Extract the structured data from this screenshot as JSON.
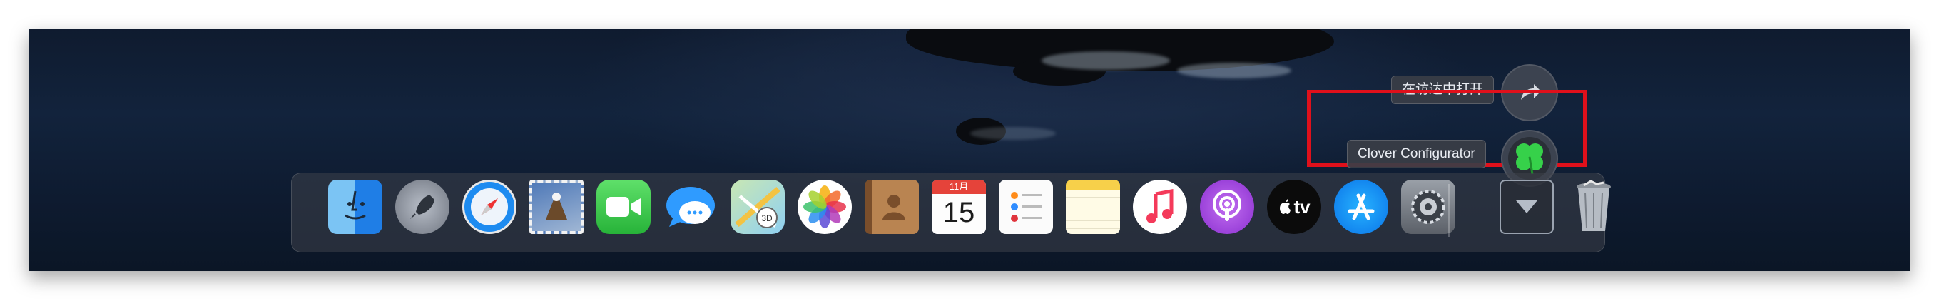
{
  "popup": {
    "open_in_finder_label": "在访达中打开",
    "clover_label": "Clover Configurator"
  },
  "dock": {
    "items": [
      {
        "name": "finder-icon"
      },
      {
        "name": "launchpad-icon"
      },
      {
        "name": "safari-icon"
      },
      {
        "name": "mail-icon"
      },
      {
        "name": "facetime-icon"
      },
      {
        "name": "messages-icon"
      },
      {
        "name": "maps-icon"
      },
      {
        "name": "photos-icon"
      },
      {
        "name": "contacts-icon"
      },
      {
        "name": "calendar-icon",
        "month": "11月",
        "day": "15"
      },
      {
        "name": "reminders-icon"
      },
      {
        "name": "notes-icon"
      },
      {
        "name": "music-icon"
      },
      {
        "name": "podcasts-icon"
      },
      {
        "name": "apple-tv-icon",
        "label": "tv"
      },
      {
        "name": "app-store-icon"
      },
      {
        "name": "system-preferences-icon"
      },
      {
        "name": "downloads-stack-icon"
      },
      {
        "name": "trash-icon"
      }
    ]
  },
  "colors": {
    "highlight": "#e0101b",
    "clover_green": "#2ecc40"
  }
}
